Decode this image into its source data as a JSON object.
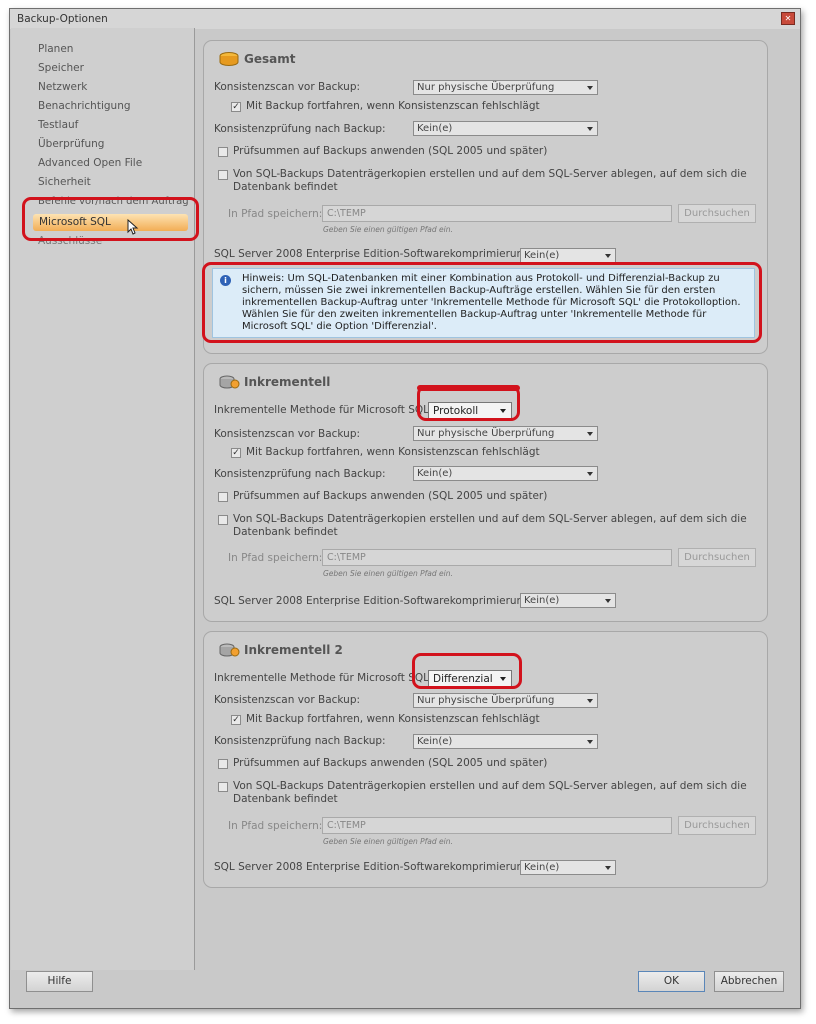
{
  "window": {
    "title": "Backup-Optionen",
    "close_glyph": "✕"
  },
  "sidebar": {
    "items": [
      {
        "label": "Planen"
      },
      {
        "label": "Speicher"
      },
      {
        "label": "Netzwerk"
      },
      {
        "label": "Benachrichtigung"
      },
      {
        "label": "Testlauf"
      },
      {
        "label": "Überprüfung"
      },
      {
        "label": "Advanced Open File"
      },
      {
        "label": "Sicherheit"
      },
      {
        "label": "Befehle vor/nach dem Auftrag"
      },
      {
        "label": "Microsoft SQL"
      },
      {
        "label": "Ausschlüsse"
      }
    ],
    "selected": "Microsoft SQL"
  },
  "gesamt": {
    "title": "Gesamt",
    "icon": "database-icon",
    "consistency_scan_label": "Konsistenzscan vor Backup:",
    "consistency_scan_value": "Nur physische Überprüfung",
    "continue_label": "Mit Backup fortfahren, wenn Konsistenzscan fehlschlägt",
    "continue_checked": true,
    "consistency_check_label": "Konsistenzprüfung nach Backup:",
    "consistency_check_value": "Kein(e)",
    "checksum_label": "Prüfsummen auf Backups anwenden (SQL 2005 und später)",
    "checksum_checked": false,
    "copy_label": "Von SQL-Backups Datenträgerkopien erstellen und auf dem SQL-Server ablegen, auf dem sich die",
    "copy_label2": "Datenbank befindet",
    "copy_checked": false,
    "path_label": "In Pfad speichern:",
    "path_value": "C:\\TEMP",
    "path_hint": "Geben Sie einen gültigen Pfad ein.",
    "browse_label": "Durchsuchen",
    "compression_label": "SQL Server 2008 Enterprise Edition-Softwarekomprimierung",
    "compression_value": "Kein(e)",
    "note_icon": "info-icon",
    "note_glyph": "i",
    "note": "Hinweis: Um SQL-Datenbanken mit einer Kombination aus Protokoll- und Differenzial-Backup zu sichern, müssen Sie zwei inkrementellen Backup-Aufträge erstellen.  Wählen Sie für den ersten inkrementellen Backup-Auftrag unter 'Inkrementelle Methode für Microsoft SQL' die Protokolloption. Wählen Sie für den zweiten inkrementellen Backup-Auftrag unter 'Inkrementelle Methode für Microsoft SQL' die Option 'Differenzial'."
  },
  "inkrementell": {
    "title": "Inkrementell",
    "icon": "database-incremental-icon",
    "method_label": "Inkrementelle Methode für Microsoft SQL:",
    "method_value": "Protokoll",
    "consistency_scan_label": "Konsistenzscan vor Backup:",
    "consistency_scan_value": "Nur physische Überprüfung",
    "continue_label": "Mit Backup fortfahren, wenn Konsistenzscan fehlschlägt",
    "continue_checked": true,
    "consistency_check_label": "Konsistenzprüfung nach Backup:",
    "consistency_check_value": "Kein(e)",
    "checksum_label": "Prüfsummen auf Backups anwenden (SQL 2005 und später)",
    "copy_label": "Von SQL-Backups Datenträgerkopien erstellen und auf dem SQL-Server ablegen, auf dem sich die",
    "copy_label2": "Datenbank befindet",
    "path_label": "In Pfad speichern:",
    "path_value": "C:\\TEMP",
    "path_hint": "Geben Sie einen gültigen Pfad ein.",
    "browse_label": "Durchsuchen",
    "compression_label": "SQL Server 2008 Enterprise Edition-Softwarekomprimierung",
    "compression_value": "Kein(e)"
  },
  "inkrementell2": {
    "title": "Inkrementell 2",
    "icon": "database-incremental-icon",
    "method_label": "Inkrementelle Methode für Microsoft SQL:",
    "method_value": "Differenzial",
    "consistency_scan_label": "Konsistenzscan vor Backup:",
    "consistency_scan_value": "Nur physische Überprüfung",
    "continue_label": "Mit Backup fortfahren, wenn Konsistenzscan fehlschlägt",
    "continue_checked": true,
    "consistency_check_label": "Konsistenzprüfung nach Backup:",
    "consistency_check_value": "Kein(e)",
    "checksum_label": "Prüfsummen auf Backups anwenden (SQL 2005 und später)",
    "copy_label": "Von SQL-Backups Datenträgerkopien erstellen und auf dem SQL-Server ablegen, auf dem sich die",
    "copy_label2": "Datenbank befindet",
    "path_label": "In Pfad speichern:",
    "path_value": "C:\\TEMP",
    "path_hint": "Geben Sie einen gültigen Pfad ein.",
    "browse_label": "Durchsuchen",
    "compression_label": "SQL Server 2008 Enterprise Edition-Softwarekomprimierung",
    "compression_value": "Kein(e)"
  },
  "footer": {
    "help_label": "Hilfe",
    "ok_label": "OK",
    "cancel_label": "Abbrechen"
  },
  "colors": {
    "highlight_red": "#d2121c",
    "selection_orange": "#f2ad55",
    "note_blue": "#dcecf8"
  },
  "check_glyph": "✓"
}
